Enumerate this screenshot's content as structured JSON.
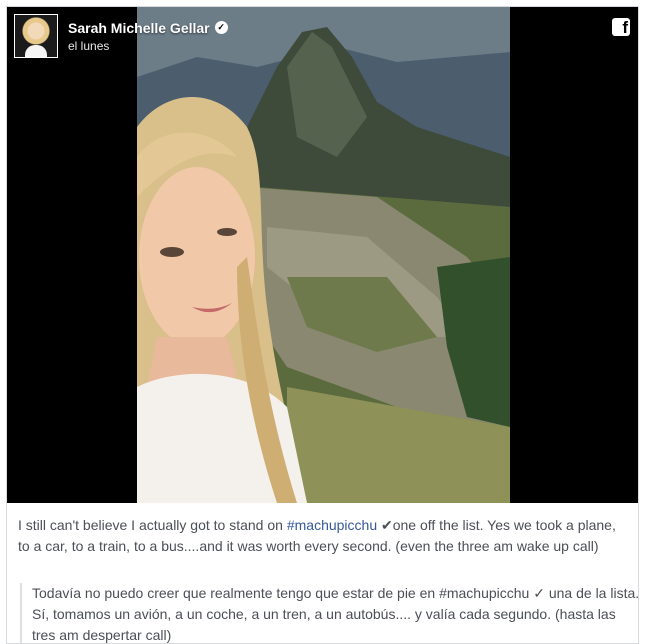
{
  "post": {
    "author": "Sarah Michelle Gellar",
    "timestamp": "el lunes",
    "verified_icon": "verified-badge-icon",
    "platform_icon": "facebook-icon",
    "platform_glyph": "f"
  },
  "caption": {
    "before": "I still can't believe I actually got to stand on ",
    "hashtag": "#machupicchu",
    "check": "✔",
    "after": "one off the list. Yes we took a plane, to a car, to a train, to a bus....and it was worth every second. (even the three am wake up call)"
  },
  "translation": {
    "before": "Todavía no puedo creer que realmente tengo que estar de pie en #machupicchu ",
    "check": "✓",
    "after": " una de la lista. Sí, tomamos un avión, a un coche, a un tren, a un autobús.... y valía cada segundo. (hasta las tres am despertar call)"
  },
  "colors": {
    "link": "#365899",
    "text": "#4b4f56",
    "media_background": "#000000"
  }
}
